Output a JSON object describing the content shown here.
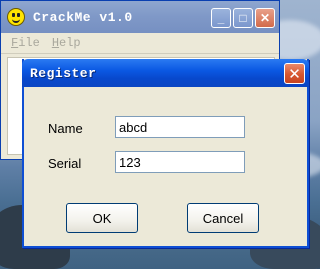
{
  "main_window": {
    "title": "CrackMe v1.0",
    "icon": "smiley-icon",
    "menu": [
      "File",
      "Help"
    ],
    "controls": {
      "minimize": "minimize-icon",
      "maximize": "maximize-icon",
      "close": "close-icon"
    }
  },
  "dialog": {
    "title": "Register",
    "close_icon": "close-icon",
    "fields": [
      {
        "label": "Name",
        "value": "abcd"
      },
      {
        "label": "Serial",
        "value": "123"
      }
    ],
    "buttons": {
      "ok": "OK",
      "cancel": "Cancel"
    }
  },
  "colors": {
    "dialog_titlebar": "#0b59e3",
    "inactive_titlebar": "#7f98c7",
    "close_button": "#d7562f",
    "window_face": "#ece9d8"
  }
}
